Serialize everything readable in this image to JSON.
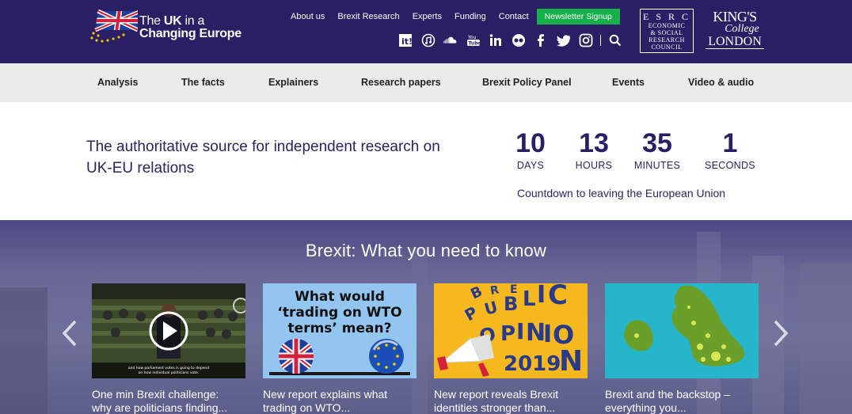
{
  "header": {
    "logo": {
      "line1_pre": "The ",
      "line1_bold": "UK",
      "line1_post": " in a",
      "line2": "Changing Europe"
    },
    "nav": [
      "About us",
      "Brexit Research",
      "Experts",
      "Funding",
      "Contact"
    ],
    "newsletter": "Newsletter Signup",
    "social_icons": [
      "itunes-u-icon",
      "music-icon",
      "soundcloud-icon",
      "youtube-icon",
      "linkedin-icon",
      "flickr-icon",
      "facebook-icon",
      "twitter-icon",
      "instagram-icon",
      "search-icon"
    ],
    "esrc": {
      "l1": "E S R C",
      "l2": "ECONOMIC",
      "l3": "& SOCIAL",
      "l4": "RESEARCH",
      "l5": "COUNCIL"
    },
    "kings": {
      "k1": "KING'S",
      "k2": "College",
      "k3": "LONDON"
    }
  },
  "main_nav": [
    "Analysis",
    "The facts",
    "Explainers",
    "Research papers",
    "Brexit Policy Panel",
    "Events",
    "Video & audio"
  ],
  "hero": {
    "tagline": "The authoritative source for independent research on UK-EU relations",
    "countdown": [
      {
        "value": "10",
        "label": "DAYS"
      },
      {
        "value": "13",
        "label": "HOURS"
      },
      {
        "value": "35",
        "label": "MINUTES"
      },
      {
        "value": "1",
        "label": "SECONDS"
      }
    ],
    "caption": "Countdown to leaving the European Union"
  },
  "feature": {
    "title": "Brexit: What you need to know",
    "cards": [
      {
        "caption_l1": "One min Brexit challenge:",
        "caption_l2": "why are politicians finding...",
        "thumb": "video-parliament",
        "subtitle1": "and how parliament votes is going to depend",
        "subtitle2": "on how individual politicians vote."
      },
      {
        "caption_l1": "New report explains what",
        "caption_l2": "trading on WTO...",
        "thumb": "wto-graphic",
        "t1": "What would",
        "t2": "‘trading on WTO",
        "t3": "terms’ mean?"
      },
      {
        "caption_l1": "New report reveals Brexit",
        "caption_l2": "identities stronger than...",
        "thumb": "public-opinion",
        "year": "2019"
      },
      {
        "caption_l1": "Brexit and the backstop –",
        "caption_l2": "everything you...",
        "thumb": "uk-map"
      }
    ]
  },
  "colors": {
    "header_bg": "#2a1e64",
    "newsletter": "#15b04a",
    "nav_bg": "#ebebeb",
    "accent_text": "#2a2560"
  }
}
